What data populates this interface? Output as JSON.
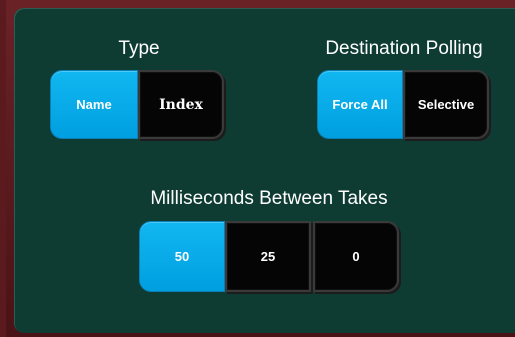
{
  "type_group": {
    "title": "Type",
    "options": [
      {
        "label": "Name",
        "selected": true
      },
      {
        "label": "Index",
        "selected": false
      }
    ]
  },
  "polling_group": {
    "title": "Destination Polling",
    "options": [
      {
        "label": "Force All",
        "selected": true
      },
      {
        "label": "Selective",
        "selected": false
      }
    ]
  },
  "takes_group": {
    "title": "Milliseconds Between Takes",
    "options": [
      {
        "label": "50",
        "selected": true
      },
      {
        "label": "25",
        "selected": false
      },
      {
        "label": "0",
        "selected": false
      }
    ]
  },
  "colors": {
    "panel_bg": "#0e3c33",
    "frame": "#5b1a1e",
    "active": "#00a6e8",
    "inactive": "#050505"
  }
}
